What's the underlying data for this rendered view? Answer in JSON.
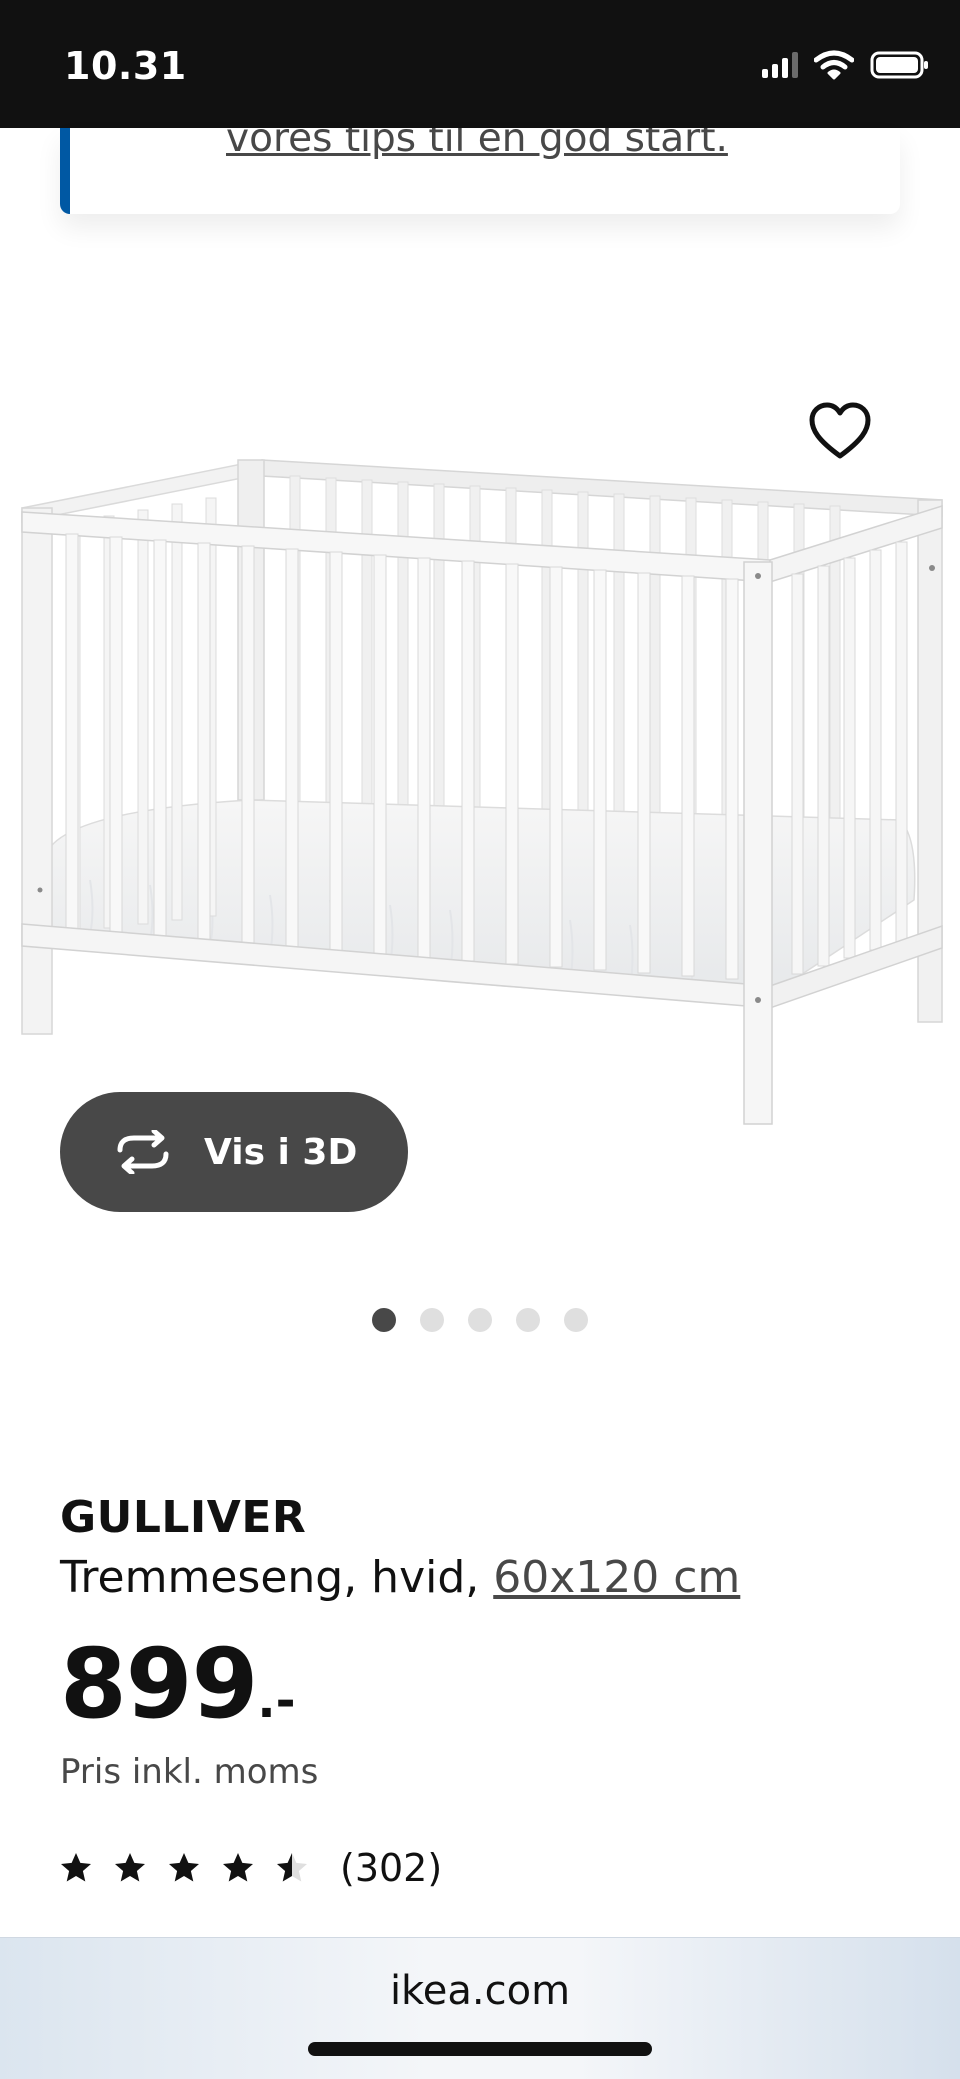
{
  "status_bar": {
    "time": "10.31"
  },
  "tip_card": {
    "link_text": "vores tips til en god start."
  },
  "image_carousel": {
    "view_3d_label": "Vis i 3D",
    "dot_count": 5,
    "active_index": 0
  },
  "product": {
    "name": "GULLIVER",
    "description": "Tremmeseng, hvid, ",
    "size_link": "60x120 cm",
    "price_value": "899",
    "price_suffix": ".-",
    "price_note": "Pris inkl. moms",
    "rating_value": 4.5,
    "rating_max": 5,
    "review_count": "(302)"
  },
  "browser": {
    "url": "ikea.com"
  },
  "colors": {
    "accent_blue": "#0058a3",
    "button_dark": "#484848",
    "text": "#111111"
  }
}
